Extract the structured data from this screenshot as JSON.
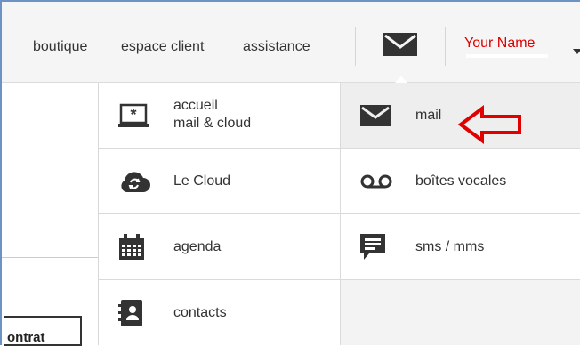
{
  "header": {
    "links": [
      "boutique",
      "espace client",
      "assistance"
    ],
    "user_name": "Your Name"
  },
  "menu": {
    "items": [
      {
        "label_line1": "accueil",
        "label_line2": "mail & cloud",
        "icon": "accueil-icon"
      },
      {
        "label": "mail",
        "icon": "envelope-icon",
        "active": true
      },
      {
        "label": "Le Cloud",
        "icon": "cloud-icon"
      },
      {
        "label": "boîtes vocales",
        "icon": "voicemail-icon"
      },
      {
        "label": "agenda",
        "icon": "calendar-icon"
      },
      {
        "label": "sms / mms",
        "icon": "sms-icon"
      },
      {
        "label": "contacts",
        "icon": "contacts-icon"
      }
    ]
  },
  "left_panel": {
    "contrat_text": "ontrat"
  },
  "colors": {
    "accent_red": "#e00000",
    "frame_blue": "#6d93c4",
    "icon_dark": "#333333"
  }
}
